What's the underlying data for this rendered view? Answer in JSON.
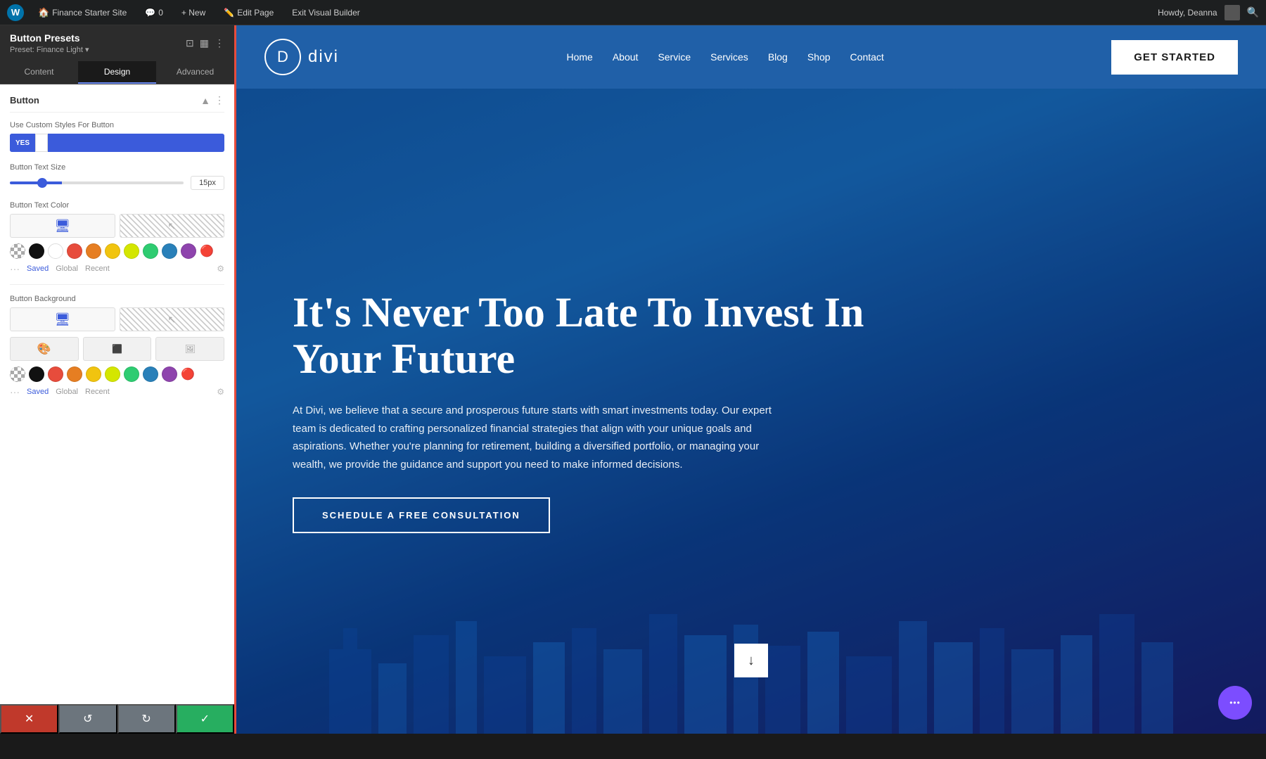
{
  "admin_bar": {
    "wp_label": "W",
    "site_name": "Finance Starter Site",
    "comments_label": "0",
    "new_label": "+ New",
    "edit_page_label": "Edit Page",
    "visual_builder_label": "Exit Visual Builder",
    "howdy_label": "Howdy, Deanna"
  },
  "panel": {
    "title": "Button Presets",
    "subtitle": "Preset: Finance Light ▾",
    "tabs": [
      "Content",
      "Design",
      "Advanced"
    ],
    "active_tab": "Design",
    "section_title": "Button",
    "toggle_label": "Use Custom Styles For Button",
    "toggle_value": "YES",
    "slider_label": "Button Text Size",
    "slider_value": "15px",
    "color_label1": "Button Text Color",
    "color_label2": "Button Background",
    "saved_label": "Saved",
    "global_label": "Global",
    "recent_label": "Recent"
  },
  "panel_footer": {
    "cancel_icon": "✕",
    "undo_icon": "↺",
    "redo_icon": "↻",
    "save_icon": "✓"
  },
  "site": {
    "logo_letter": "D",
    "logo_text": "divi",
    "nav_items": [
      "Home",
      "About",
      "Service",
      "Services",
      "Blog",
      "Shop",
      "Contact"
    ],
    "cta_button": "GET STARTED",
    "hero_title": "It's Never Too Late To Invest In Your Future",
    "hero_description": "At Divi, we believe that a secure and prosperous future starts with smart investments today. Our expert team is dedicated to crafting personalized financial strategies that align with your unique goals and aspirations. Whether you're planning for retirement, building a diversified portfolio, or managing your wealth, we provide the guidance and support you need to make informed decisions.",
    "hero_cta": "SCHEDULE A FREE CONSULTATION",
    "scroll_arrow": "↓",
    "floating_dots": "•••"
  },
  "colors": {
    "swatches": [
      {
        "name": "checker",
        "bg": "checker",
        "hex": null
      },
      {
        "name": "black",
        "bg": "#111111",
        "hex": "#111111"
      },
      {
        "name": "white",
        "bg": "#ffffff",
        "hex": "#ffffff"
      },
      {
        "name": "red",
        "bg": "#e74c3c",
        "hex": "#e74c3c"
      },
      {
        "name": "orange",
        "bg": "#e67e22",
        "hex": "#e67e22"
      },
      {
        "name": "yellow",
        "bg": "#f1c40f",
        "hex": "#f1c40f"
      },
      {
        "name": "yellow-green",
        "bg": "#d4e600",
        "hex": "#d4e600"
      },
      {
        "name": "green",
        "bg": "#2ecc71",
        "hex": "#2ecc71"
      },
      {
        "name": "blue",
        "bg": "#2980b9",
        "hex": "#2980b9"
      },
      {
        "name": "purple",
        "bg": "#8e44ad",
        "hex": "#8e44ad"
      }
    ],
    "swatches_bottom": [
      {
        "name": "checker-bottom",
        "bg": "checker",
        "hex": null
      },
      {
        "name": "black-bottom",
        "bg": "#111111",
        "hex": "#111111"
      },
      {
        "name": "red-bottom",
        "bg": "#e74c3c",
        "hex": "#e74c3c"
      },
      {
        "name": "orange-bottom",
        "bg": "#e67e22",
        "hex": "#e67e22"
      },
      {
        "name": "yellow-bottom",
        "bg": "#f1c40f",
        "hex": "#f1c40f"
      },
      {
        "name": "yellow-green-bottom",
        "bg": "#d4e600",
        "hex": "#d4e600"
      },
      {
        "name": "green-bottom",
        "bg": "#2ecc71",
        "hex": "#2ecc71"
      },
      {
        "name": "blue-bottom",
        "bg": "#2980b9",
        "hex": "#2980b9"
      },
      {
        "name": "purple-bottom",
        "bg": "#8e44ad",
        "hex": "#8e44ad"
      }
    ]
  }
}
